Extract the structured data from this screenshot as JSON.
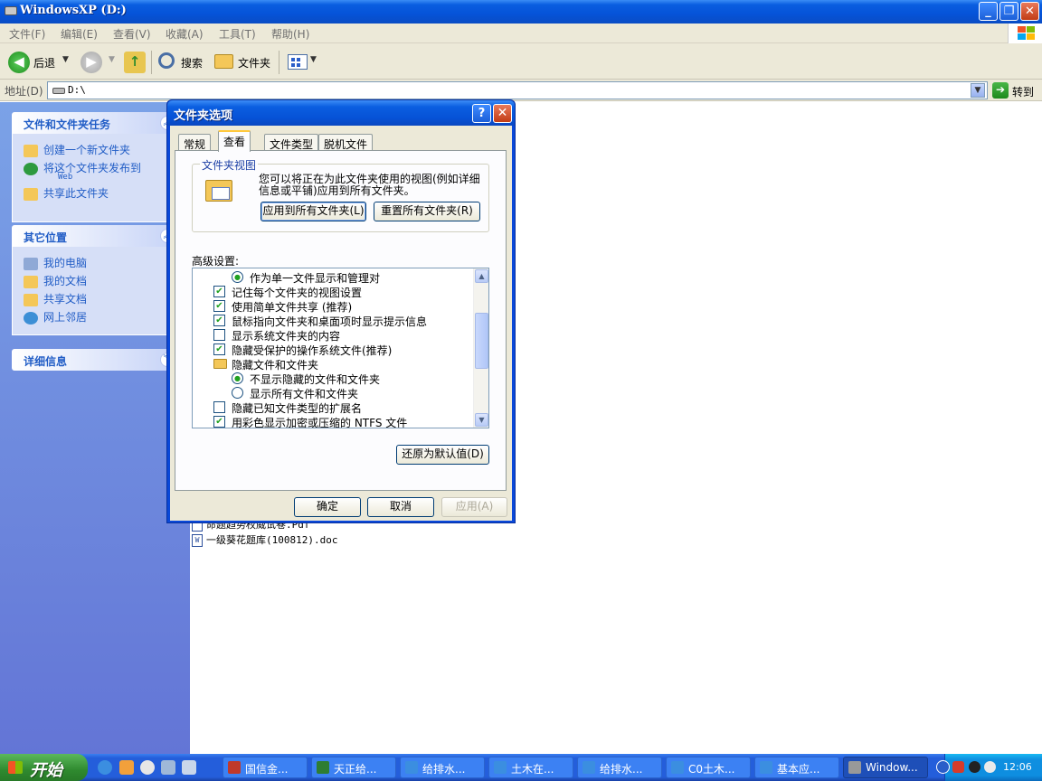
{
  "window": {
    "title": "WindowsXP (D:)"
  },
  "menubar": {
    "items": [
      "文件(F)",
      "编辑(E)",
      "查看(V)",
      "收藏(A)",
      "工具(T)",
      "帮助(H)"
    ]
  },
  "toolbar": {
    "back": "后退",
    "search": "搜索",
    "folders": "文件夹"
  },
  "address": {
    "label": "地址(D)",
    "value": "D:\\",
    "go": "转到"
  },
  "taskpane": {
    "tasks": {
      "title": "文件和文件夹任务",
      "items": [
        "创建一个新文件夹",
        "将这个文件夹发布到",
        "共享此文件夹"
      ],
      "web_suffix": "Web"
    },
    "places": {
      "title": "其它位置",
      "items": [
        "我的电脑",
        "我的文档",
        "共享文档",
        "网上邻居"
      ]
    },
    "details": {
      "title": "详细信息"
    }
  },
  "files": [
    {
      "name": "命题趋势权威试卷.Pdf"
    },
    {
      "name": "一级葵花题库(100812).doc"
    }
  ],
  "dialog": {
    "title": "文件夹选项",
    "tabs": [
      "常规",
      "查看",
      "文件类型",
      "脱机文件"
    ],
    "active_tab": "查看",
    "folder_view": {
      "label": "文件夹视图",
      "description": "您可以将正在为此文件夹使用的视图(例如详细信息或平铺)应用到所有文件夹。",
      "apply_all": "应用到所有文件夹(L)",
      "reset_all": "重置所有文件夹(R)"
    },
    "advanced_label": "高级设置:",
    "advanced_items": [
      {
        "type": "radio",
        "checked": true,
        "label": "作为单一文件显示和管理对"
      },
      {
        "type": "checkbox",
        "checked": true,
        "label": "记住每个文件夹的视图设置"
      },
      {
        "type": "checkbox",
        "checked": true,
        "label": "使用简单文件共享 (推荐)"
      },
      {
        "type": "checkbox",
        "checked": true,
        "label": "鼠标指向文件夹和桌面项时显示提示信息"
      },
      {
        "type": "checkbox",
        "checked": false,
        "label": "显示系统文件夹的内容"
      },
      {
        "type": "checkbox",
        "checked": true,
        "label": "隐藏受保护的操作系统文件(推荐)"
      },
      {
        "type": "folder",
        "checked": false,
        "label": "隐藏文件和文件夹"
      },
      {
        "type": "radio",
        "checked": true,
        "label": "不显示隐藏的文件和文件夹"
      },
      {
        "type": "radio",
        "checked": false,
        "label": "显示所有文件和文件夹"
      },
      {
        "type": "checkbox",
        "checked": false,
        "label": "隐藏已知文件类型的扩展名"
      },
      {
        "type": "checkbox",
        "checked": true,
        "label": "用彩色显示加密或压缩的 NTFS 文件"
      }
    ],
    "restore_defaults": "还原为默认值(D)",
    "ok": "确定",
    "cancel": "取消",
    "apply": "应用(A)"
  },
  "taskbar": {
    "start": "开始",
    "tasks": [
      {
        "label": "国信金..."
      },
      {
        "label": "天正给..."
      },
      {
        "label": "给排水..."
      },
      {
        "label": "土木在..."
      },
      {
        "label": "给排水..."
      },
      {
        "label": "C0土木..."
      },
      {
        "label": "基本应..."
      },
      {
        "label": "Window..."
      }
    ],
    "clock": "12:06"
  }
}
